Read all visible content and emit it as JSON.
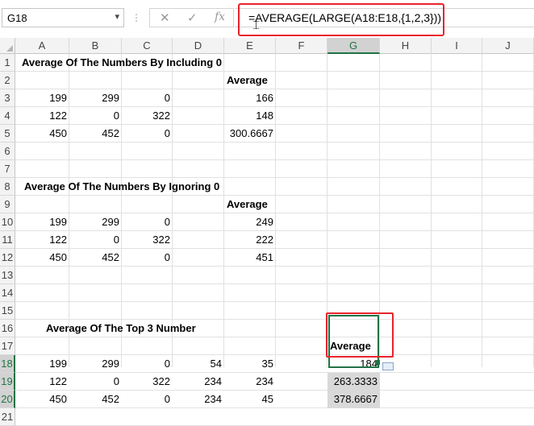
{
  "formula_bar": {
    "name_box": "G18",
    "name_box_dropdown": "▾",
    "separator": "⋮",
    "cancel_symbol": "✕",
    "enter_symbol": "✓",
    "fx_label": "fx",
    "formula": "=AVERAGE(LARGE(A18:E18,{1,2,3}))"
  },
  "columns": [
    "A",
    "B",
    "C",
    "D",
    "E",
    "F",
    "G",
    "H",
    "I",
    "J"
  ],
  "selected_column": "G",
  "rows": [
    "1",
    "2",
    "3",
    "4",
    "5",
    "6",
    "7",
    "8",
    "9",
    "10",
    "11",
    "12",
    "13",
    "14",
    "15",
    "16",
    "17",
    "18",
    "19",
    "20",
    "21"
  ],
  "selected_rows": [
    "18",
    "19",
    "20"
  ],
  "sections": {
    "s1_title": "Average Of The Numbers By Including 0",
    "s1_avg_header": "Average",
    "s1_data": [
      [
        "199",
        "299",
        "0",
        "",
        "166"
      ],
      [
        "122",
        "0",
        "322",
        "",
        "148"
      ],
      [
        "450",
        "452",
        "0",
        "",
        "300.6667"
      ]
    ],
    "s2_title": "Average Of The Numbers By Ignoring 0",
    "s2_avg_header": "Average",
    "s2_data": [
      [
        "199",
        "299",
        "0",
        "",
        "249"
      ],
      [
        "122",
        "0",
        "322",
        "",
        "222"
      ],
      [
        "450",
        "452",
        "0",
        "",
        "451"
      ]
    ],
    "s3_title": "Average Of The Top 3 Number",
    "s3_avg_header": "Average",
    "s3_data": [
      [
        "199",
        "299",
        "0",
        "54",
        "35"
      ],
      [
        "122",
        "0",
        "322",
        "234",
        "234"
      ],
      [
        "450",
        "452",
        "0",
        "234",
        "45"
      ]
    ],
    "s3_results": [
      "184",
      "263.3333",
      "378.6667"
    ]
  },
  "colors": {
    "highlight_box": "#e8232c",
    "selection": "#217346"
  }
}
